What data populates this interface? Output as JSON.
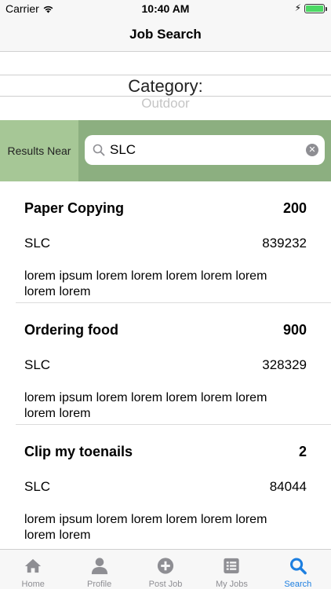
{
  "status_bar": {
    "carrier": "Carrier",
    "time": "10:40 AM"
  },
  "nav": {
    "title": "Job Search"
  },
  "picker": {
    "label": "Category:",
    "value": "Outdoor"
  },
  "search": {
    "results_near_label": "Results Near",
    "value": "SLC"
  },
  "jobs": [
    {
      "title": "Paper Copying",
      "pay": "200",
      "location": "SLC",
      "zip": "839232",
      "description": "lorem ipsum lorem lorem lorem lorem lorem lorem lorem"
    },
    {
      "title": "Ordering food",
      "pay": "900",
      "location": "SLC",
      "zip": "328329",
      "description": "lorem ipsum lorem lorem lorem lorem lorem lorem lorem"
    },
    {
      "title": "Clip my toenails",
      "pay": "2",
      "location": "SLC",
      "zip": "84044",
      "description": "lorem ipsum lorem lorem lorem lorem lorem lorem lorem"
    }
  ],
  "tabs": [
    {
      "label": "Home",
      "icon": "home-icon"
    },
    {
      "label": "Profile",
      "icon": "person-icon"
    },
    {
      "label": "Post Job",
      "icon": "plus-circle-icon"
    },
    {
      "label": "My Jobs",
      "icon": "list-icon"
    },
    {
      "label": "Search",
      "icon": "search-icon",
      "active": true
    }
  ],
  "colors": {
    "accent": "#1d7fe0",
    "search_bar_bg": "#8caf80",
    "results_near_bg": "#a6c796",
    "battery": "#4cd964"
  }
}
